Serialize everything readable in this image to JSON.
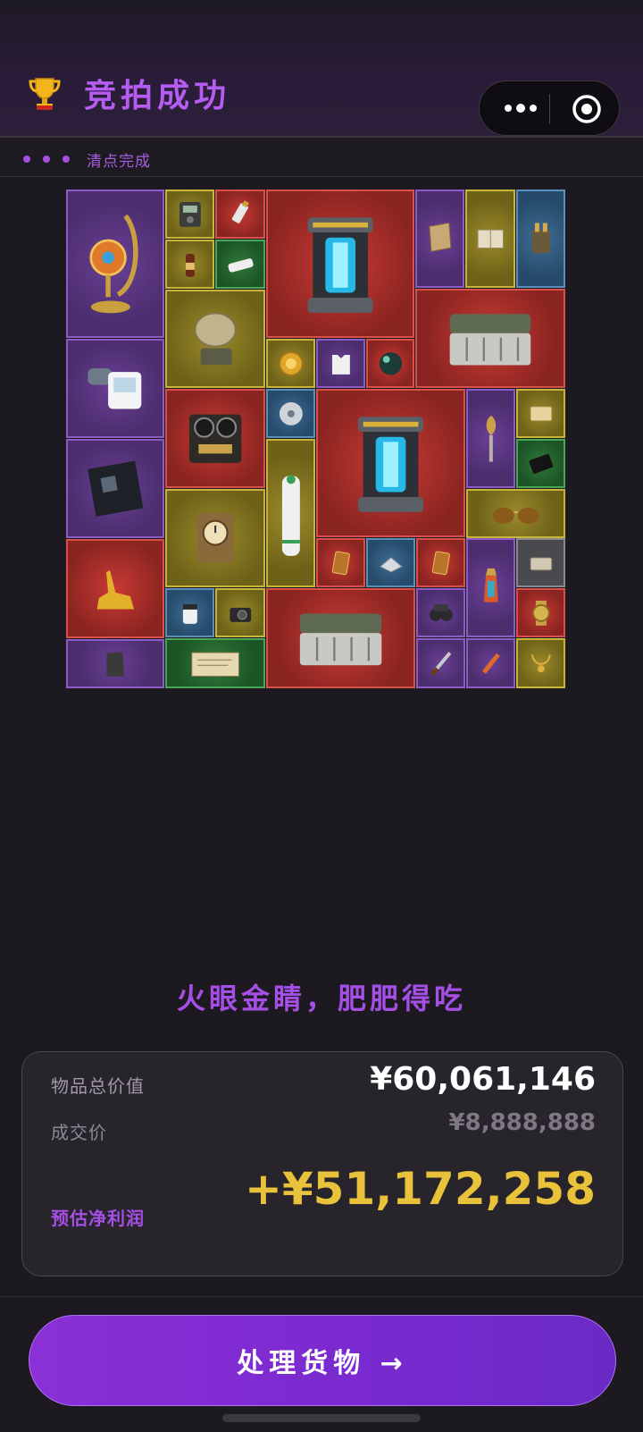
{
  "header": {
    "title": "竞拍成功",
    "subtitle": "清点完成"
  },
  "icons": {
    "trophy": "trophy-icon",
    "menu": "more-dots-icon",
    "close": "target-circle-icon"
  },
  "grid": {
    "items": [
      {
        "name": "moroccan-lamp",
        "rarity": "purple"
      },
      {
        "name": "multimeter",
        "rarity": "yellow"
      },
      {
        "name": "usb-drive",
        "rarity": "red"
      },
      {
        "name": "energy-core-reactor",
        "rarity": "red"
      },
      {
        "name": "old-map",
        "rarity": "purple"
      },
      {
        "name": "old-book",
        "rarity": "yellow"
      },
      {
        "name": "bullet-ammo",
        "rarity": "blue"
      },
      {
        "name": "drink-bottle",
        "rarity": "yellow"
      },
      {
        "name": "power-strip",
        "rarity": "green"
      },
      {
        "name": "satellite-dish",
        "rarity": "yellow"
      },
      {
        "name": "military-crate",
        "rarity": "red"
      },
      {
        "name": "blood-pressure-monitor",
        "rarity": "purple"
      },
      {
        "name": "gold-medal",
        "rarity": "yellow"
      },
      {
        "name": "body-armor-plate",
        "rarity": "purple"
      },
      {
        "name": "glass-orb",
        "rarity": "red"
      },
      {
        "name": "reel-tape-recorder",
        "rarity": "red"
      },
      {
        "name": "cd-disc",
        "rarity": "blue"
      },
      {
        "name": "energy-core-reactor",
        "rarity": "red"
      },
      {
        "name": "golden-ornament",
        "rarity": "purple"
      },
      {
        "name": "cigarette-box",
        "rarity": "yellow"
      },
      {
        "name": "motherboard",
        "rarity": "purple"
      },
      {
        "name": "oxygen-tank",
        "rarity": "yellow"
      },
      {
        "name": "black-card",
        "rarity": "green"
      },
      {
        "name": "antique-clock",
        "rarity": "yellow"
      },
      {
        "name": "aviator-sunglasses",
        "rarity": "yellow"
      },
      {
        "name": "golden-gazelle",
        "rarity": "red"
      },
      {
        "name": "tarot-card",
        "rarity": "red"
      },
      {
        "name": "silver-tray",
        "rarity": "blue"
      },
      {
        "name": "tarot-card",
        "rarity": "red"
      },
      {
        "name": "lantern",
        "rarity": "purple"
      },
      {
        "name": "tea-box",
        "rarity": "gray"
      },
      {
        "name": "chemical-jar",
        "rarity": "blue"
      },
      {
        "name": "camera",
        "rarity": "yellow"
      },
      {
        "name": "military-crate",
        "rarity": "red"
      },
      {
        "name": "night-vision-goggles",
        "rarity": "purple"
      },
      {
        "name": "gold-watch",
        "rarity": "red"
      },
      {
        "name": "meteorite-rock",
        "rarity": "purple"
      },
      {
        "name": "old-document",
        "rarity": "green"
      },
      {
        "name": "dagger",
        "rarity": "purple"
      },
      {
        "name": "pen-tool",
        "rarity": "purple"
      },
      {
        "name": "gold-necklace",
        "rarity": "yellow"
      }
    ]
  },
  "slogan": "火眼金睛，肥肥得吃",
  "summary": {
    "total_value_label": "物品总价值",
    "total_value": "¥60,061,146",
    "deal_price_label": "成交价",
    "deal_price": "¥8,888,888",
    "profit_label": "预估净利润",
    "profit": "+¥51,172,258"
  },
  "cta": {
    "label": "处理货物 →"
  },
  "colors": {
    "accent": "#a64fe6",
    "profit": "#e8c23a",
    "background": "#1c1a20"
  }
}
